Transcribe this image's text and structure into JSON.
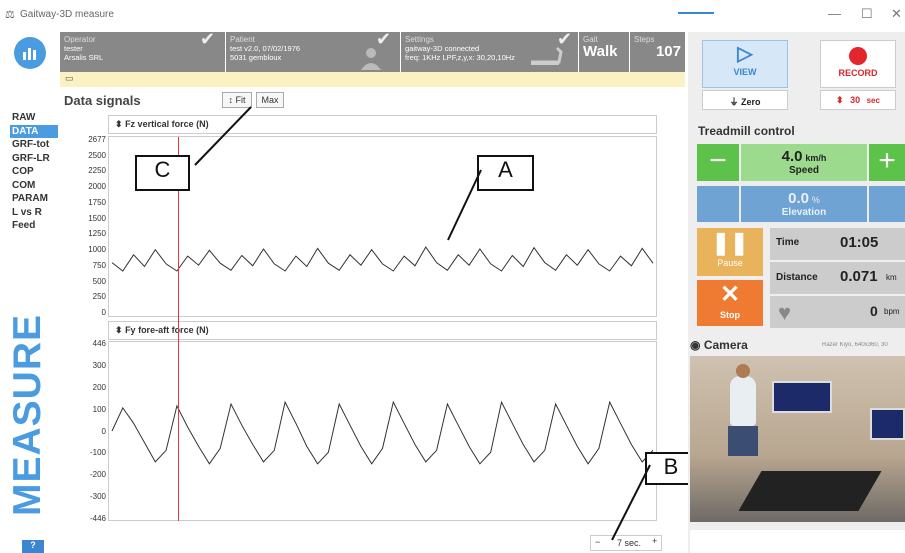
{
  "window": {
    "title": "Gaitway-3D measure"
  },
  "nav": [
    "RAW",
    "DATA",
    "GRF-tot",
    "GRF-LR",
    "COP",
    "COM",
    "PARAM",
    "L vs R",
    "Feed"
  ],
  "nav_active": "DATA",
  "sidebar": {
    "brand": "MEASURE",
    "help": "?"
  },
  "header": {
    "operator": {
      "label": "Operator",
      "line1": "tester",
      "line2": "Arsalis SRL"
    },
    "patient": {
      "label": "Patient",
      "line1": "test v2.0, 07/02/1976",
      "line2": "5031 gembloux"
    },
    "settings": {
      "label": "Settings",
      "line1": "gaitway-3D connected",
      "line2": "freq: 1KHz   LPF,z,y,x: 30,20,10Hz"
    },
    "gait": {
      "label": "Gait",
      "value": "Walk"
    },
    "steps": {
      "label": "Steps",
      "value": "107"
    }
  },
  "signals": {
    "title": "Data signals",
    "fit": "Fit",
    "max": "Max",
    "chart1_title": "Fz vertical force (N)",
    "chart2_title": "Fy fore-aft force (N)",
    "timescale": "7 sec."
  },
  "callouts": {
    "a": "A",
    "b": "B",
    "c": "C"
  },
  "controls": {
    "view": "VIEW",
    "zero": "Zero",
    "record": "RECORD",
    "rec_time": "30",
    "rec_unit": "sec"
  },
  "treadmill": {
    "title": "Treadmill control",
    "speed_value": "4.0",
    "speed_unit": "km/h",
    "speed_label": "Speed",
    "elev_value": "0.0",
    "elev_unit": "%",
    "elev_label": "Elevation",
    "pause": "Pause",
    "stop": "Stop",
    "time_label": "Time",
    "time_value": "01:05",
    "distance_label": "Distance",
    "distance_value": "0.071",
    "distance_unit": "km",
    "hr_value": "0",
    "hr_unit": "bpm"
  },
  "camera": {
    "title": "Camera",
    "info": "Razer Kiyo, 640x360, 30"
  },
  "chart_data": [
    {
      "type": "line",
      "title": "Fz vertical force (N)",
      "ylim": [
        0,
        2677
      ],
      "y_ticks": [
        "2677",
        "2500",
        "2250",
        "2000",
        "1750",
        "1500",
        "1250",
        "1000",
        "750",
        "500",
        "250",
        "0"
      ],
      "series": [
        {
          "values": [
            780,
            650,
            900,
            720,
            980,
            760,
            650,
            880,
            740,
            970,
            770,
            660,
            890,
            730,
            990,
            760,
            650,
            880,
            720,
            1000,
            770,
            660,
            900,
            740,
            980,
            760,
            650,
            880,
            730,
            1020,
            780,
            660,
            900,
            740,
            990,
            760,
            650,
            890,
            720,
            1010,
            780,
            660,
            900,
            740,
            980,
            760,
            650,
            880,
            730,
            1000,
            770
          ]
        }
      ]
    },
    {
      "type": "line",
      "title": "Fy fore-aft force (N)",
      "ylim": [
        -446,
        446
      ],
      "y_ticks": [
        "446",
        "300",
        "200",
        "100",
        "0",
        "-100",
        "-200",
        "-300",
        "-446"
      ],
      "series": [
        {
          "values": [
            0,
            120,
            40,
            -60,
            -160,
            -100,
            130,
            20,
            -80,
            -170,
            -90,
            140,
            30,
            -70,
            -160,
            -100,
            150,
            40,
            -80,
            -170,
            -110,
            140,
            30,
            -80,
            -170,
            -90,
            150,
            40,
            -70,
            -160,
            -100,
            140,
            30,
            -80,
            -170,
            -110,
            150,
            40,
            -70,
            -160,
            -100,
            140,
            30,
            -80,
            -170,
            -90,
            150,
            40,
            -70,
            -160,
            -100
          ]
        }
      ]
    }
  ]
}
